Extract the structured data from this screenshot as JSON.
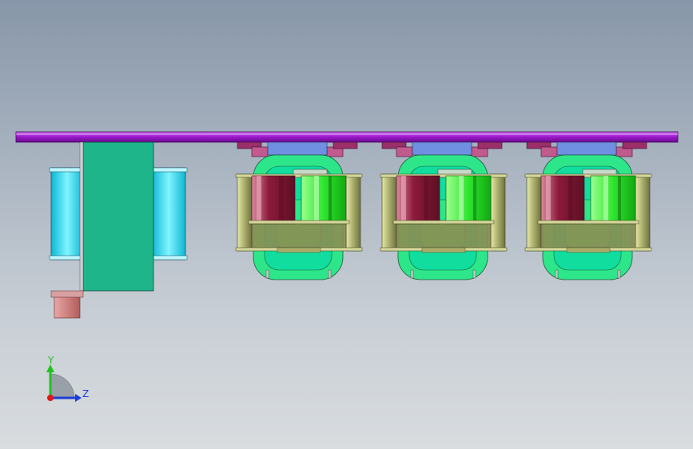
{
  "viewport": {
    "background_top": "#8796a8",
    "background_bottom": "#d8dcdf"
  },
  "model": {
    "plate_color": "#9a17c9",
    "transformer_core_color": "#1fb58a",
    "coil_cyan_color": "#22dff0",
    "bracket_color": "#c9706f",
    "winding_red_color": "#8c1a3a",
    "winding_green_color": "#2ee62e",
    "frame_olive_color": "#a9ad6a",
    "inner_core_color": "#10dd9e",
    "top_block_color": "#6f8fe0",
    "mount_color": "#9b2f6a",
    "inductor_count": 3
  },
  "triad": {
    "y_label": "Y",
    "z_label": "Z",
    "y_color": "#1ec41e",
    "z_color": "#1b3fd6",
    "x_color": "#e01818"
  }
}
